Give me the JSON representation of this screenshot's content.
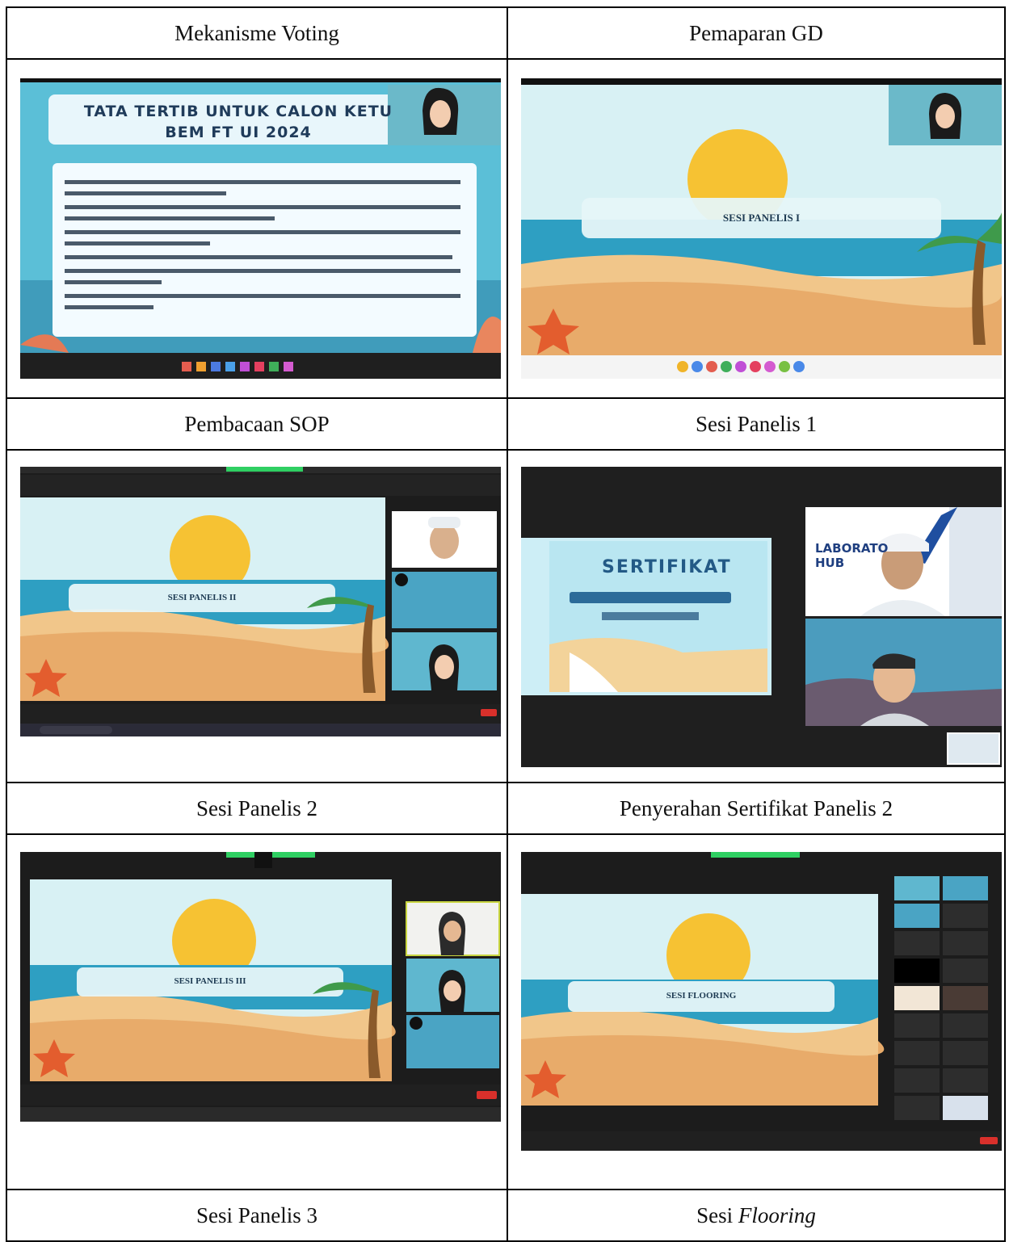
{
  "table": {
    "captions": [
      [
        "Mekanisme Voting",
        "Pemaparan GD"
      ],
      [
        "Pembacaan SOP",
        "Sesi Panelis 1"
      ],
      [
        "Sesi Panelis 2",
        "Penyerahan Sertifikat Panelis 2"
      ],
      [
        "Sesi Panelis 3",
        "Sesi ",
        "Flooring"
      ]
    ]
  },
  "screens": {
    "voting": {
      "title_line1": "TATA TERTIB UNTUK CALON KETU",
      "title_line2": "BEM FT UI 2024"
    },
    "gd": {
      "banner": "SESI PANELIS I"
    },
    "sop": {
      "banner": "SESI PANELIS II"
    },
    "panelis1": {
      "cert_title": "SERTIFIKAT",
      "lab_title": "LABORATO",
      "lab_sub": "HUB"
    },
    "panelis2": {
      "banner": "SESI PANELIS III"
    },
    "flooring": {
      "banner": "SESI FLOORING"
    }
  }
}
